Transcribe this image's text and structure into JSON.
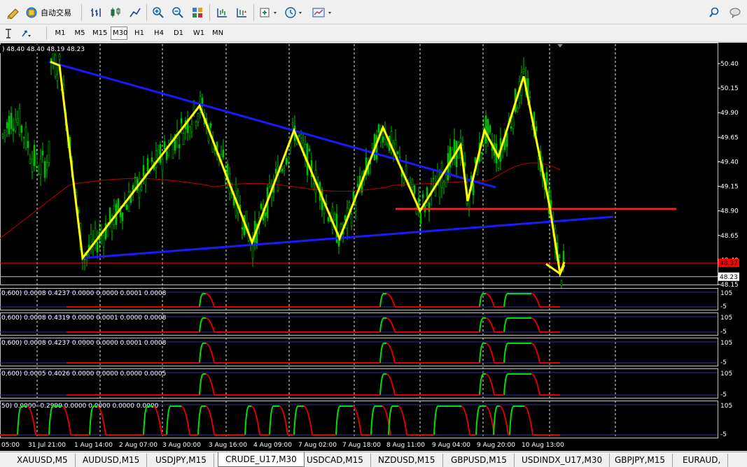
{
  "toolbar": {
    "auto_trading_label": "自动交易",
    "timeframes": [
      "M1",
      "M5",
      "M15",
      "M30",
      "H1",
      "H4",
      "D1",
      "W1",
      "MN"
    ],
    "active_timeframe": "M30"
  },
  "chart": {
    "symbol_tab": "CRUDE_U17,M30",
    "ohlc_header": "48.40 48.40 48.19 48.23",
    "price_axis": {
      "ticks": [
        "50.40",
        "50.15",
        "49.90",
        "49.65",
        "49.40",
        "49.15",
        "48.90",
        "48.65",
        "48.40",
        "48.15"
      ],
      "current_price_red": "48.37",
      "current_price_box": "48.23"
    },
    "time_axis": [
      "05:00",
      "31 Jul 21:00",
      "1 Aug 14:00",
      "2 Aug 07:00",
      "3 Aug 00:00",
      "3 Aug 16:00",
      "4 Aug 09:00",
      "7 Aug 02:00",
      "7 Aug 18:00",
      "8 Aug 11:00",
      "9 Aug 04:00",
      "9 Aug 20:00",
      "10 Aug 13:00"
    ],
    "colors": {
      "background": "#000000",
      "bull_candle": "#00c000",
      "bear_candle": "#00c000",
      "zigzag": "#ffff00",
      "trendline": "#1a1aff",
      "support_line": "#ff1a1a",
      "moving_average": "#c00000",
      "indicator_up": "#00e000",
      "indicator_down": "#e00000"
    }
  },
  "indicators": [
    {
      "header": "0,600) 0.0008 0.4237 0.0000 0.0000 0.0001 0.0008",
      "top_label": "105",
      "bottom_label": "-5"
    },
    {
      "header": "0,600) 0.0008 0.4319 0.0000 0.0001 0.0000 0.0008",
      "top_label": "105",
      "bottom_label": "-5"
    },
    {
      "header": "0,600) 0.0008 0.4237 0.0000 0.0000 0.0001 0.0008",
      "top_label": "105",
      "bottom_label": "-5"
    },
    {
      "header": "0,600) 0.0005 0.4026 0.0000 0.0000 0.0000 0.0005",
      "top_label": "105",
      "bottom_label": "-5"
    },
    {
      "header": "50) 0.0000 -0.2999 0.0000 0.0000 0.0000 0.0000",
      "top_label": "105",
      "bottom_label": "-5"
    }
  ],
  "tabs": [
    "XAUUSD,M5",
    "AUDUSD,M15",
    "USDJPY,M15",
    "CRUDE_U17,M30",
    "USDCAD,M15",
    "NZDUSD,M15",
    "GBPUSD,M15",
    "USDINDX_U17,M30",
    "GBPJPY,M15",
    "EURAUD,"
  ],
  "active_tab": "CRUDE_U17,M30"
}
